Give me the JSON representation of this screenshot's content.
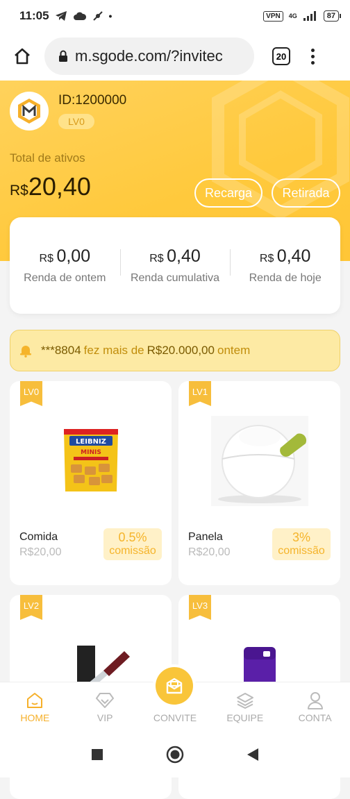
{
  "status_bar": {
    "time": "11:05",
    "vpn": "VPN",
    "network": "4G",
    "battery": "87"
  },
  "browser": {
    "url": "m.sgode.com/?invitec",
    "tab_count": "20"
  },
  "account": {
    "id_label": "ID:1200000",
    "level": "LV0",
    "assets_label": "Total de ativos",
    "assets_currency": "R$",
    "assets_value": "20,40",
    "recharge_label": "Recarga",
    "withdraw_label": "Retirada"
  },
  "stats": [
    {
      "currency": "R$",
      "value": "0,00",
      "label": "Renda de ontem"
    },
    {
      "currency": "R$",
      "value": "0,40",
      "label": "Renda cumulativa"
    },
    {
      "currency": "R$",
      "value": "0,40",
      "label": "Renda de hoje"
    }
  ],
  "notice": {
    "user": "***8804",
    "text": "fez mais de",
    "amount": "R$20.000,00",
    "tail": "ontem"
  },
  "products": [
    {
      "level": "LV0",
      "name": "Comida",
      "price": "R$20,00",
      "commission_pct": "0.5%",
      "commission_word": "comissão",
      "image": "biscuit-package"
    },
    {
      "level": "LV1",
      "name": "Panela",
      "price": "R$20,00",
      "commission_pct": "3%",
      "commission_word": "comissão",
      "image": "white-pot"
    },
    {
      "level": "LV2",
      "name": "",
      "price": "",
      "image": "knife"
    },
    {
      "level": "LV3",
      "name": "",
      "price": "",
      "image": "purple-bottle"
    }
  ],
  "nav": [
    {
      "label": "HOME",
      "icon": "home-icon",
      "active": true
    },
    {
      "label": "VIP",
      "icon": "diamond-icon",
      "active": false
    },
    {
      "label": "CONVITE",
      "icon": "invite-icon",
      "active": false
    },
    {
      "label": "EQUIPE",
      "icon": "layers-icon",
      "active": false
    },
    {
      "label": "CONTA",
      "icon": "user-icon",
      "active": false
    }
  ],
  "colors": {
    "accent": "#f6b02a",
    "hero": "#ffc93c",
    "notice_bg": "#fdeaa4"
  }
}
